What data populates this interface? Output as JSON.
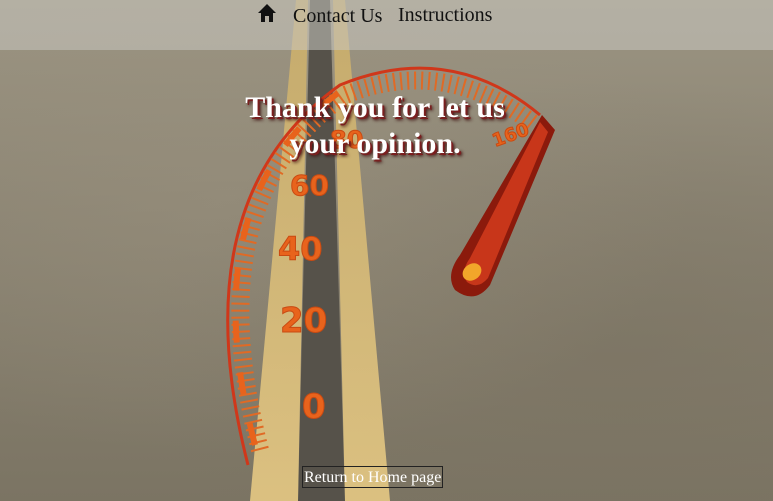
{
  "nav": {
    "home_icon": "home-icon",
    "contact": "Contact Us",
    "instructions": "Instructions"
  },
  "gauge": {
    "tick_labels": [
      "0",
      "20",
      "40",
      "60",
      "80",
      "160"
    ],
    "accent_color": "#e8631c",
    "needle_color": "#b8250f"
  },
  "message": {
    "line1": "Thank you for let us",
    "line2": "your opinion."
  },
  "return_button": "Return to Home page"
}
